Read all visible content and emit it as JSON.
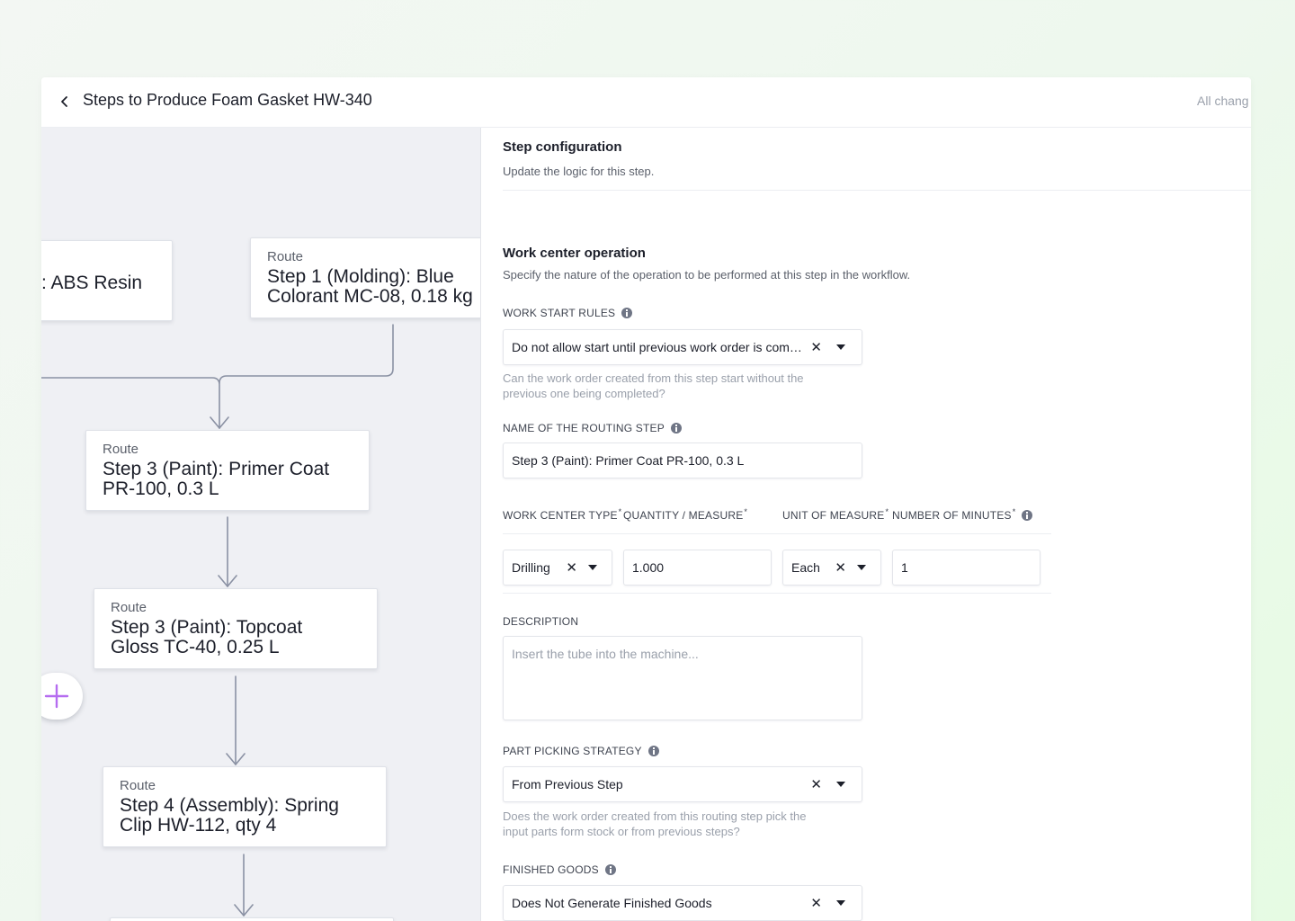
{
  "header": {
    "title": "Steps to Produce Foam Gasket HW-340",
    "save_status": "All chang"
  },
  "canvas": {
    "nodes": [
      {
        "kind": "",
        "title": "): ABS Resin"
      },
      {
        "kind": "Route",
        "title": "Step 1 (Molding): Blue",
        "title2": "Colorant MC-08, 0.18 kg"
      },
      {
        "kind": "Route",
        "title": "Step 3 (Paint): Primer Coat",
        "title2": "PR-100, 0.3 L"
      },
      {
        "kind": "Route",
        "title": "Step 3 (Paint): Topcoat",
        "title2": "Gloss TC-40, 0.25 L"
      },
      {
        "kind": "Route",
        "title": "Step 4 (Assembly): Spring",
        "title2": "Clip HW-112, qty 4"
      }
    ]
  },
  "panel": {
    "title": "Step configuration",
    "subtitle": "Update the logic for this step.",
    "section_title": "Work center operation",
    "section_subtitle": "Specify the nature of the operation to be performed at this step in the workflow.",
    "work_start": {
      "label": "WORK START RULES",
      "value": "Do not allow start until previous work order is compl...",
      "help1": "Can the work order created from this step start without the",
      "help2": "previous one being completed?"
    },
    "routing_name": {
      "label": "NAME OF THE ROUTING STEP",
      "value": "Step 3 (Paint): Primer Coat PR-100, 0.3 L"
    },
    "row": {
      "work_center_type_label": "WORK CENTER TYPE",
      "quantity_label": "QUANTITY / MEASURE",
      "uom_label": "UNIT OF MEASURE",
      "minutes_label": "NUMBER OF MINUTES",
      "work_center_type": "Drilling",
      "quantity": "1.000",
      "uom": "Each",
      "minutes": "1"
    },
    "description": {
      "label": "DESCRIPTION",
      "placeholder": "Insert the tube into the machine..."
    },
    "part_picking": {
      "label": "PART PICKING STRATEGY",
      "value": "From Previous Step",
      "help1": "Does the work order created from this routing step pick the",
      "help2": "input parts form stock or from previous steps?"
    },
    "finished_goods": {
      "label": "FINISHED GOODS",
      "value": "Does Not Generate Finished Goods"
    }
  },
  "icons": {
    "back": "chevron-left-icon",
    "add": "plus-icon",
    "clear": "close-icon",
    "dropdown": "caret-down-icon",
    "info": "info-icon"
  },
  "colors": {
    "accent": "#b56cf0",
    "canvas_bg": "#eff0f4",
    "connector": "#8a91a3"
  }
}
